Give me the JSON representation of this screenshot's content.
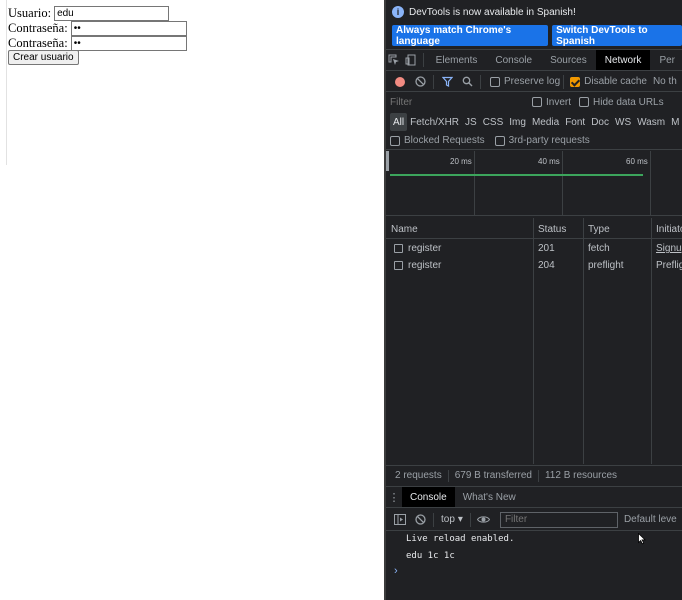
{
  "form": {
    "user_label": "Usuario:",
    "user_value": "edu",
    "pass_label": "Contraseña:",
    "pass_value": "••",
    "pass2_label": "Contraseña:",
    "pass2_value": "••",
    "submit_label": "Crear usuario"
  },
  "devtools": {
    "infobar": {
      "message": "DevTools is now available in Spanish!",
      "btn_match": "Always match Chrome's language",
      "btn_switch": "Switch DevTools to Spanish"
    },
    "tabs": [
      "Elements",
      "Console",
      "Sources",
      "Network",
      "Per"
    ],
    "active_tab": "Network",
    "toolbar": {
      "preserve_log": "Preserve log",
      "disable_cache": "Disable cache",
      "throttle": "No th"
    },
    "filter": {
      "placeholder": "Filter",
      "invert": "Invert",
      "hide_data_urls": "Hide data URLs"
    },
    "types": [
      "All",
      "Fetch/XHR",
      "JS",
      "CSS",
      "Img",
      "Media",
      "Font",
      "Doc",
      "WS",
      "Wasm",
      "M"
    ],
    "blocked_requests": "Blocked Requests",
    "third_party": "3rd-party requests",
    "timeline_ticks": [
      "20 ms",
      "40 ms",
      "60 ms"
    ],
    "table": {
      "headers": [
        "Name",
        "Status",
        "Type",
        "Initiato"
      ],
      "rows": [
        {
          "name": "register",
          "status": "201",
          "type": "fetch",
          "initiator": "Signup"
        },
        {
          "name": "register",
          "status": "204",
          "type": "preflight",
          "initiator": "Prefligh"
        }
      ]
    },
    "status": {
      "requests": "2 requests",
      "transferred": "679 B transferred",
      "resources": "112 B resources"
    },
    "drawer": {
      "tab_console": "Console",
      "tab_whats_new": "What's New",
      "context": "top",
      "filter_placeholder": "Filter",
      "levels": "Default leve"
    },
    "console_lines": [
      "Live reload enabled.",
      "edu 1c 1c"
    ]
  },
  "colors": {
    "devtools_bg": "#202124",
    "accent_blue": "#1a73e8",
    "checkbox_orange": "#f29900",
    "record_red": "#f28b82",
    "timeline_green": "#3ca55c"
  }
}
